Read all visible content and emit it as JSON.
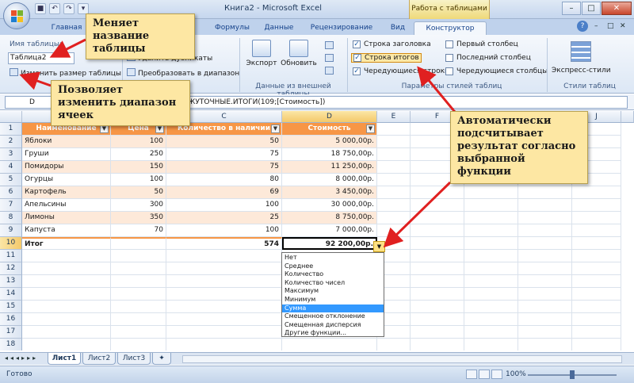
{
  "window": {
    "title": "Книга2 - Microsoft Excel",
    "context_tab_title": "Работа с таблицами"
  },
  "tabs": [
    "Главная",
    "Формулы",
    "Данные",
    "Рецензирование",
    "Вид",
    "Конструктор"
  ],
  "ribbon": {
    "table_name_label": "Имя таблицы:",
    "table_name_value": "Таблица2",
    "resize_label": "Изменить размер таблицы",
    "remove_duplicates": "Удалить дубликаты",
    "convert_to_range": "Преобразовать в диапазон",
    "export_label": "Экспорт",
    "refresh_label": "Обновить",
    "ext_group_label": "Данные из внешней таблицы",
    "header_row": "Строка заголовка",
    "total_row": "Строка итогов",
    "banded_rows": "Чередующиеся строки",
    "first_column": "Первый столбец",
    "last_column": "Последний столбец",
    "banded_columns": "Чередующиеся столбцы",
    "style_options_label": "Параметры стилей таблиц",
    "quick_styles": "Экспресс-стили",
    "table_styles_label": "Стили таблиц"
  },
  "formula_bar": {
    "cell_ref": "D",
    "formula": "ЕЖУТОЧНЫЕ.ИТОГИ(109;[Стоимость])"
  },
  "columns": [
    "C",
    "D",
    "E",
    "F",
    "J"
  ],
  "table": {
    "headers": [
      "Наименование",
      "Цена",
      "Количество в наличии",
      "Стоимость"
    ],
    "rows": [
      [
        "Яблоки",
        "100",
        "50",
        "5 000,00р."
      ],
      [
        "Груши",
        "250",
        "75",
        "18 750,00р."
      ],
      [
        "Помидоры",
        "150",
        "75",
        "11 250,00р."
      ],
      [
        "Огурцы",
        "100",
        "80",
        "8 000,00р."
      ],
      [
        "Картофель",
        "50",
        "69",
        "3 450,00р."
      ],
      [
        "Апельсины",
        "300",
        "100",
        "30 000,00р."
      ],
      [
        "Лимоны",
        "350",
        "25",
        "8 750,00р."
      ],
      [
        "Капуста",
        "70",
        "100",
        "7 000,00р."
      ]
    ],
    "total": [
      "Итог",
      "",
      "574",
      "92 200,00р."
    ]
  },
  "row_numbers": [
    "1",
    "2",
    "3",
    "4",
    "5",
    "6",
    "7",
    "8",
    "9",
    "10",
    "11",
    "12",
    "13",
    "14",
    "15",
    "16",
    "17",
    "18"
  ],
  "dropdown_options": [
    "Нет",
    "Среднее",
    "Количество",
    "Количество чисел",
    "Максимум",
    "Минимум",
    "Сумма",
    "Смещенное отклонение",
    "Смещенная дисперсия",
    "Другие функции..."
  ],
  "dropdown_selected_index": 6,
  "sheets": [
    "Лист1",
    "Лист2",
    "Лист3"
  ],
  "status": {
    "ready": "Готово",
    "zoom": "100%"
  },
  "callouts": {
    "rename": "Меняет название таблицы",
    "resize": "Позволяет изменить диапазон ячеек",
    "auto": "Автоматически подсчитывает результат согласно выбранной функции"
  },
  "colors": {
    "header_orange": "#f79646",
    "band_peach": "#fde9d9",
    "callout_yellow": "#fde7a3",
    "arrow_red": "#e02020",
    "selected_blue": "#3399ff"
  }
}
